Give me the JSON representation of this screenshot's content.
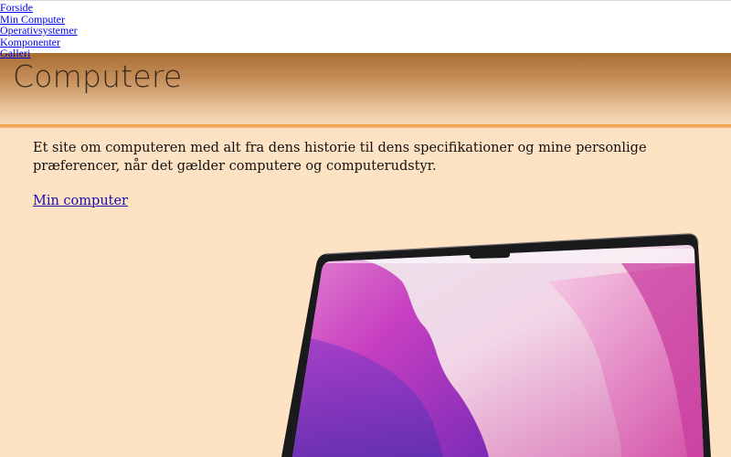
{
  "nav": {
    "items": [
      {
        "label": "Forside"
      },
      {
        "label": "Min Computer"
      },
      {
        "label": "Operativsystemer"
      },
      {
        "label": "Komponenter"
      },
      {
        "label": "Galleri"
      }
    ]
  },
  "hero": {
    "title": "Computere"
  },
  "intro": {
    "text": "Et site om computeren med alt fra dens historie til dens specifikationer og mine personlige præferencer, når det gælder computere og computerudstyr.",
    "link_label": "Min computer"
  },
  "colors": {
    "background": "#fde3c3",
    "hero_top": "#a86f33",
    "accent_line": "#f39b47",
    "link": "#1a0dab"
  }
}
